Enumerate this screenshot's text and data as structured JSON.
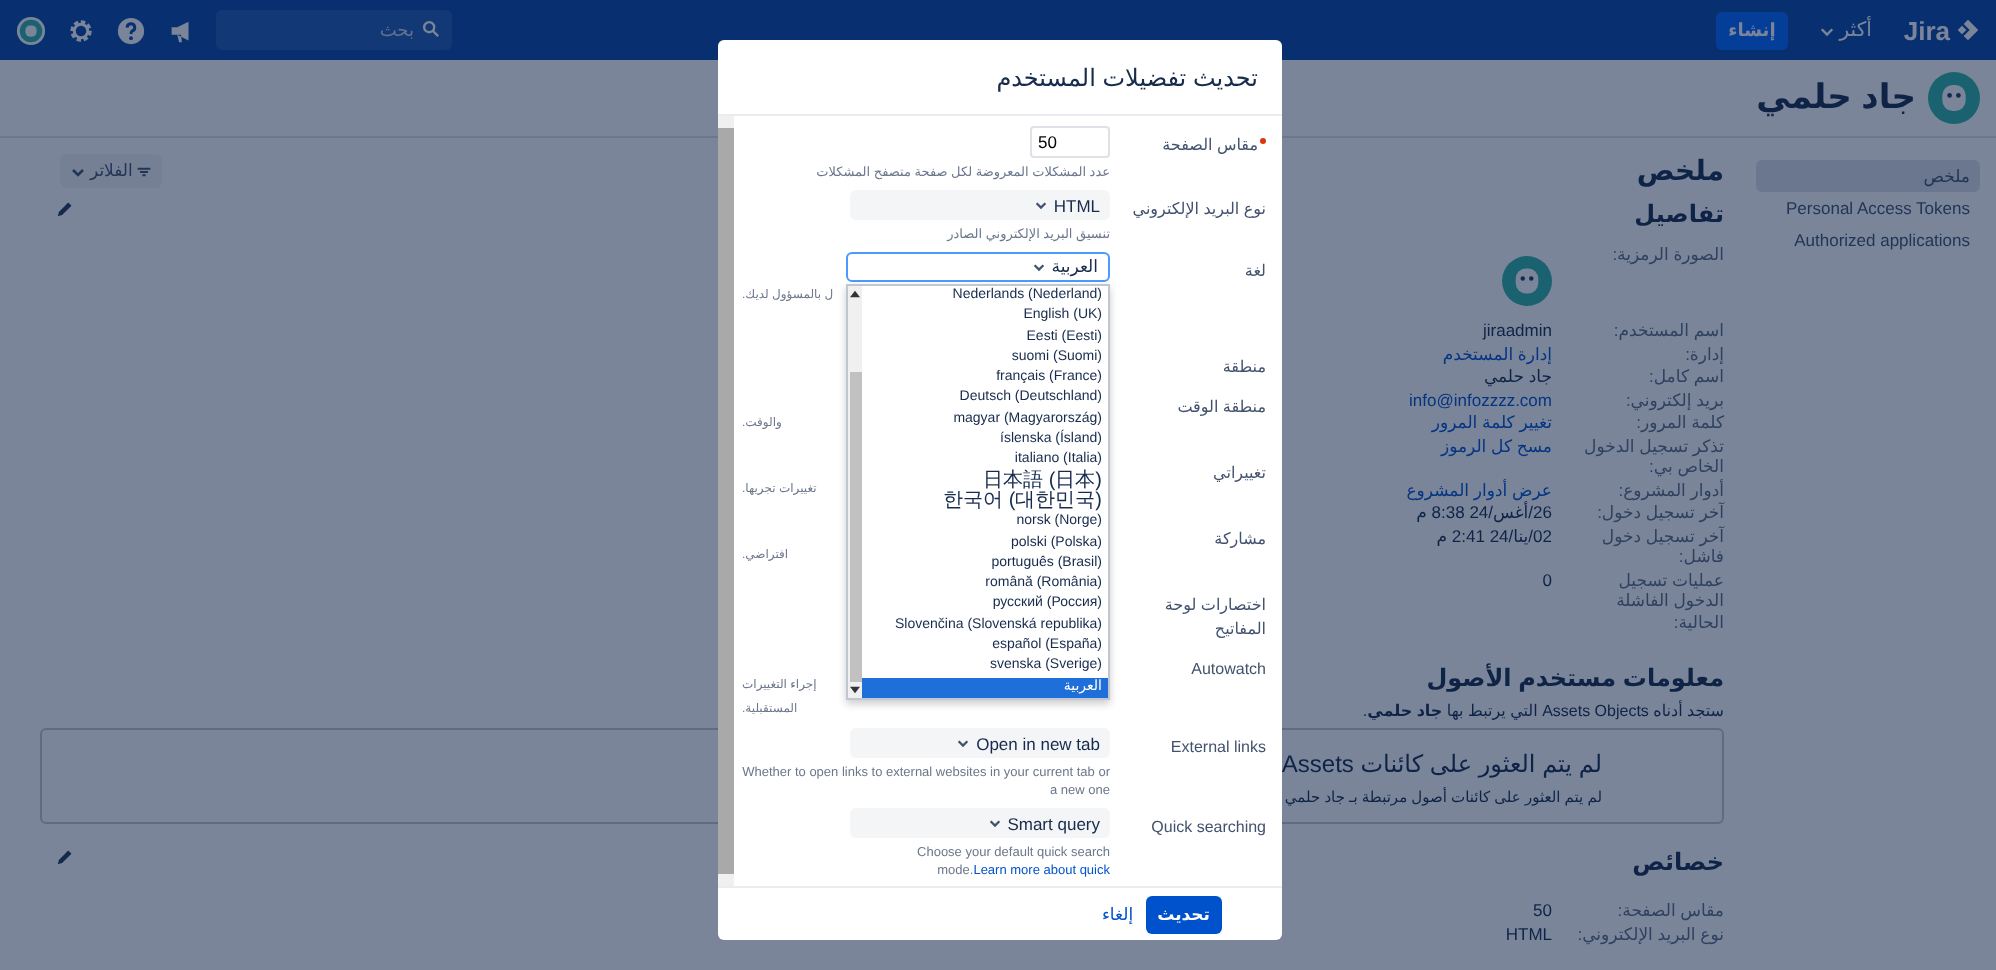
{
  "topbar": {
    "logo": "Jira",
    "more": "أكثر",
    "create": "إنشاء",
    "search": {
      "placeholder": "بحث"
    }
  },
  "profile": {
    "name": "جاد حلمي"
  },
  "sidebar": {
    "items": [
      {
        "label": "ملخص",
        "selected": true
      },
      {
        "label": "Personal Access Tokens",
        "selected": false
      },
      {
        "label": "Authorized applications",
        "selected": false
      }
    ]
  },
  "summary": {
    "title": "ملخص",
    "filter_button": "الفلاتر"
  },
  "details": {
    "title": "تفاصيل",
    "rows": [
      {
        "label": "الصورة الرمزية:",
        "kind": "avatar"
      },
      {
        "label": "اسم المستخدم:",
        "kind": "text",
        "value": "jiraadmin"
      },
      {
        "label": "إدارة:",
        "kind": "link",
        "value": "إدارة المستخدم"
      },
      {
        "label": "اسم كامل:",
        "kind": "text",
        "value": "جاد حلمي"
      },
      {
        "label": "بريد إلكتروني:",
        "kind": "link",
        "value": "info@infozzzz.com"
      },
      {
        "label": "كلمة المرور:",
        "kind": "link",
        "value": "تغيير كلمة المرور"
      },
      {
        "label": "تذكر تسجيل الدخول الخاص بي:",
        "kind": "link",
        "value": "مسح كل الرموز"
      },
      {
        "label": "أدوار المشروع:",
        "kind": "link",
        "value": "عرض أدوار المشروع"
      },
      {
        "label": "آخر تسجيل دخول:",
        "kind": "text",
        "value": "26/أغس/24 8:38 م"
      },
      {
        "label": "آخر تسجيل دخول فاشل:",
        "kind": "text",
        "value": "02/ينا/24 2:41 م"
      },
      {
        "label": "عمليات تسجيل الدخول الفاشلة الحالية:",
        "kind": "text",
        "value": "0"
      }
    ]
  },
  "assets": {
    "title": "معلومات مستخدم الأصول",
    "intro": "ستجد أدناه Assets Objects التي يرتبط بها **جاد حلمي**.",
    "empty_title": "لم يتم العثور على كائنات Assets",
    "empty_text": "لم يتم العثور على كائنات أصول مرتبطة بـ جاد حلمي"
  },
  "properties": {
    "title": "خصائص",
    "rows": [
      {
        "label": "مقاس الصفحة:",
        "value": "50"
      },
      {
        "label": "نوع البريد الإلكتروني:",
        "value": "HTML"
      }
    ]
  },
  "dialog": {
    "title": "تحديث تفضيلات المستخدم",
    "fields": [
      {
        "label": "مقاس الصفحة",
        "required": true,
        "kind": "number",
        "value": "50",
        "hint": [
          "عدد المشكلات المعروضة لكل صفحة متصفح المشكلات"
        ]
      },
      {
        "label": "نوع البريد الإلكتروني",
        "required": false,
        "kind": "select",
        "value": "HTML",
        "hint": [
          "تنسيق البريد الإلكتروني الصادر"
        ]
      },
      {
        "label": "لغة",
        "required": false,
        "kind": "select",
        "value": "العربية",
        "open": true,
        "hint": [
          "ل بالمسؤول لديك."
        ],
        "options": [
          {
            "label": "Nederlands (Nederland)",
            "selected": false
          },
          {
            "label": "English (UK)",
            "selected": false
          },
          {
            "label": "Eesti (Eesti)",
            "selected": false
          },
          {
            "label": "suomi (Suomi)",
            "selected": false
          },
          {
            "label": "français (France)",
            "selected": false
          },
          {
            "label": "Deutsch (Deutschland)",
            "selected": false
          },
          {
            "label": "magyar (Magyarország)",
            "selected": false
          },
          {
            "label": "íslenska (Ísland)",
            "selected": false
          },
          {
            "label": "italiano (Italia)",
            "selected": false
          },
          {
            "label": "日本語 (日本)",
            "selected": false
          },
          {
            "label": "한국어 (대한민국)",
            "selected": false
          },
          {
            "label": "norsk (Norge)",
            "selected": false
          },
          {
            "label": "polski (Polska)",
            "selected": false
          },
          {
            "label": "português (Brasil)",
            "selected": false
          },
          {
            "label": "română (România)",
            "selected": false
          },
          {
            "label": "русский (Россия)",
            "selected": false
          },
          {
            "label": "Slovenčina (Slovenská republika)",
            "selected": false
          },
          {
            "label": "español (España)",
            "selected": false
          },
          {
            "label": "svenska (Sverige)",
            "selected": false
          },
          {
            "label": "العربية",
            "selected": true
          }
        ]
      },
      {
        "label": "منطقة",
        "required": false,
        "kind": "covered"
      },
      {
        "label": "منطقة الوقت",
        "required": false,
        "kind": "covered",
        "hint": [
          "والوقت."
        ]
      },
      {
        "label": "تغييراتي",
        "required": false,
        "kind": "covered",
        "hint": [
          "تغييرات تجريها."
        ]
      },
      {
        "label": "مشاركة",
        "required": false,
        "kind": "covered",
        "hint": [
          "افتراضي."
        ]
      },
      {
        "label": "اختصارات لوحة المفاتيح",
        "required": false,
        "kind": "covered"
      },
      {
        "label": "Autowatch",
        "required": false,
        "kind": "covered",
        "hint": [
          "إجراء التغييرات",
          "المستقبلية."
        ]
      },
      {
        "label": "External links",
        "required": false,
        "kind": "select",
        "value": "Open in new tab",
        "hint": [
          "Whether to open links to external websites in your current tab or a new one"
        ]
      },
      {
        "label": "Quick searching",
        "required": false,
        "kind": "select",
        "value": "Smart query",
        "hint": [
          "Choose your default quick search mode."
        ],
        "hint_link": "Learn more about quick"
      }
    ],
    "submit": "تحديث",
    "cancel": "إلغاء"
  }
}
